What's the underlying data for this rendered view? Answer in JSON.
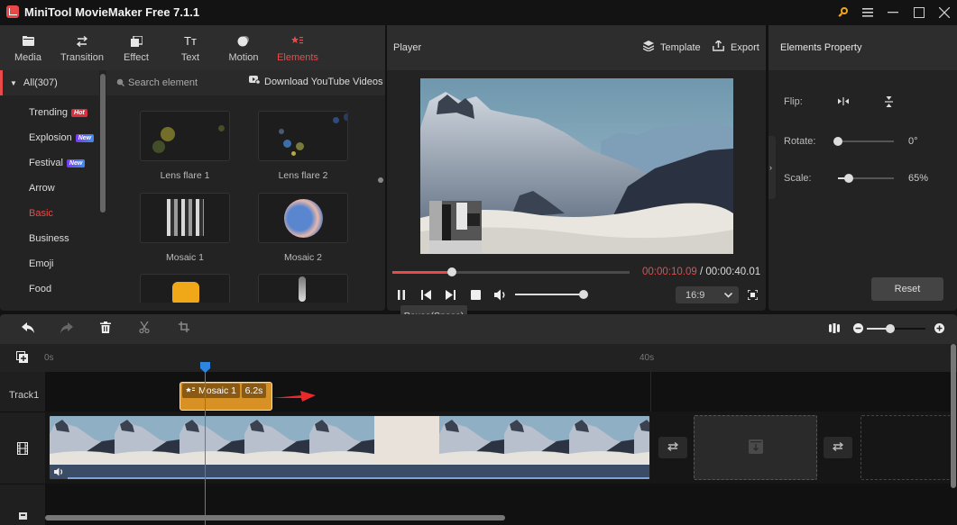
{
  "app": {
    "title": "MiniTool MovieMaker Free 7.1.1"
  },
  "window_controls": {
    "key_icon": "key-icon",
    "menu_icon": "hamburger-icon",
    "minimize": "minimize-icon",
    "maximize": "maximize-icon",
    "close": "close-icon"
  },
  "toolbar": {
    "items": [
      {
        "label": "Media",
        "icon": "folder-icon"
      },
      {
        "label": "Transition",
        "icon": "swap-arrows-icon"
      },
      {
        "label": "Effect",
        "icon": "layers-icon"
      },
      {
        "label": "Text",
        "icon": "text-icon"
      },
      {
        "label": "Motion",
        "icon": "motion-ball-icon"
      },
      {
        "label": "Elements",
        "icon": "elements-star-icon",
        "active": true
      }
    ]
  },
  "categories": {
    "all_label": "All(307)",
    "items": [
      {
        "label": "Trending",
        "badge": "Hot"
      },
      {
        "label": "Explosion",
        "badge": "New"
      },
      {
        "label": "Festival",
        "badge": "New"
      },
      {
        "label": "Arrow"
      },
      {
        "label": "Basic",
        "active": true
      },
      {
        "label": "Business"
      },
      {
        "label": "Emoji"
      },
      {
        "label": "Food"
      }
    ]
  },
  "search": {
    "placeholder": "Search element",
    "download_label": "Download YouTube Videos"
  },
  "elements": [
    {
      "label": "Lens flare 1"
    },
    {
      "label": "Lens flare 2"
    },
    {
      "label": "Mosaic 1"
    },
    {
      "label": "Mosaic 2"
    },
    {
      "label": ""
    },
    {
      "label": ""
    }
  ],
  "player": {
    "title": "Player",
    "template_label": "Template",
    "export_label": "Export",
    "current_time": "00:00:10.09",
    "separator": " / ",
    "total_time": "00:00:40.01",
    "progress": 0.25,
    "volume": 1.0,
    "aspect_ratio": "16:9",
    "tooltip": "Pause(Space)"
  },
  "properties": {
    "title": "Elements Property",
    "flip_label": "Flip:",
    "rotate_label": "Rotate:",
    "rotate_value": "0°",
    "rotate_fraction": 0.0,
    "scale_label": "Scale:",
    "scale_value": "65%",
    "scale_fraction": 0.2,
    "reset_label": "Reset"
  },
  "timeline": {
    "ruler_start": "0s",
    "ruler_end": "40s",
    "track1_label": "Track1",
    "clip_label": "Mosaic 1",
    "clip_duration": "6.2s",
    "zoom_fraction": 0.4,
    "accent": "#e94b4b",
    "playhead_color": "#2f86e0"
  }
}
